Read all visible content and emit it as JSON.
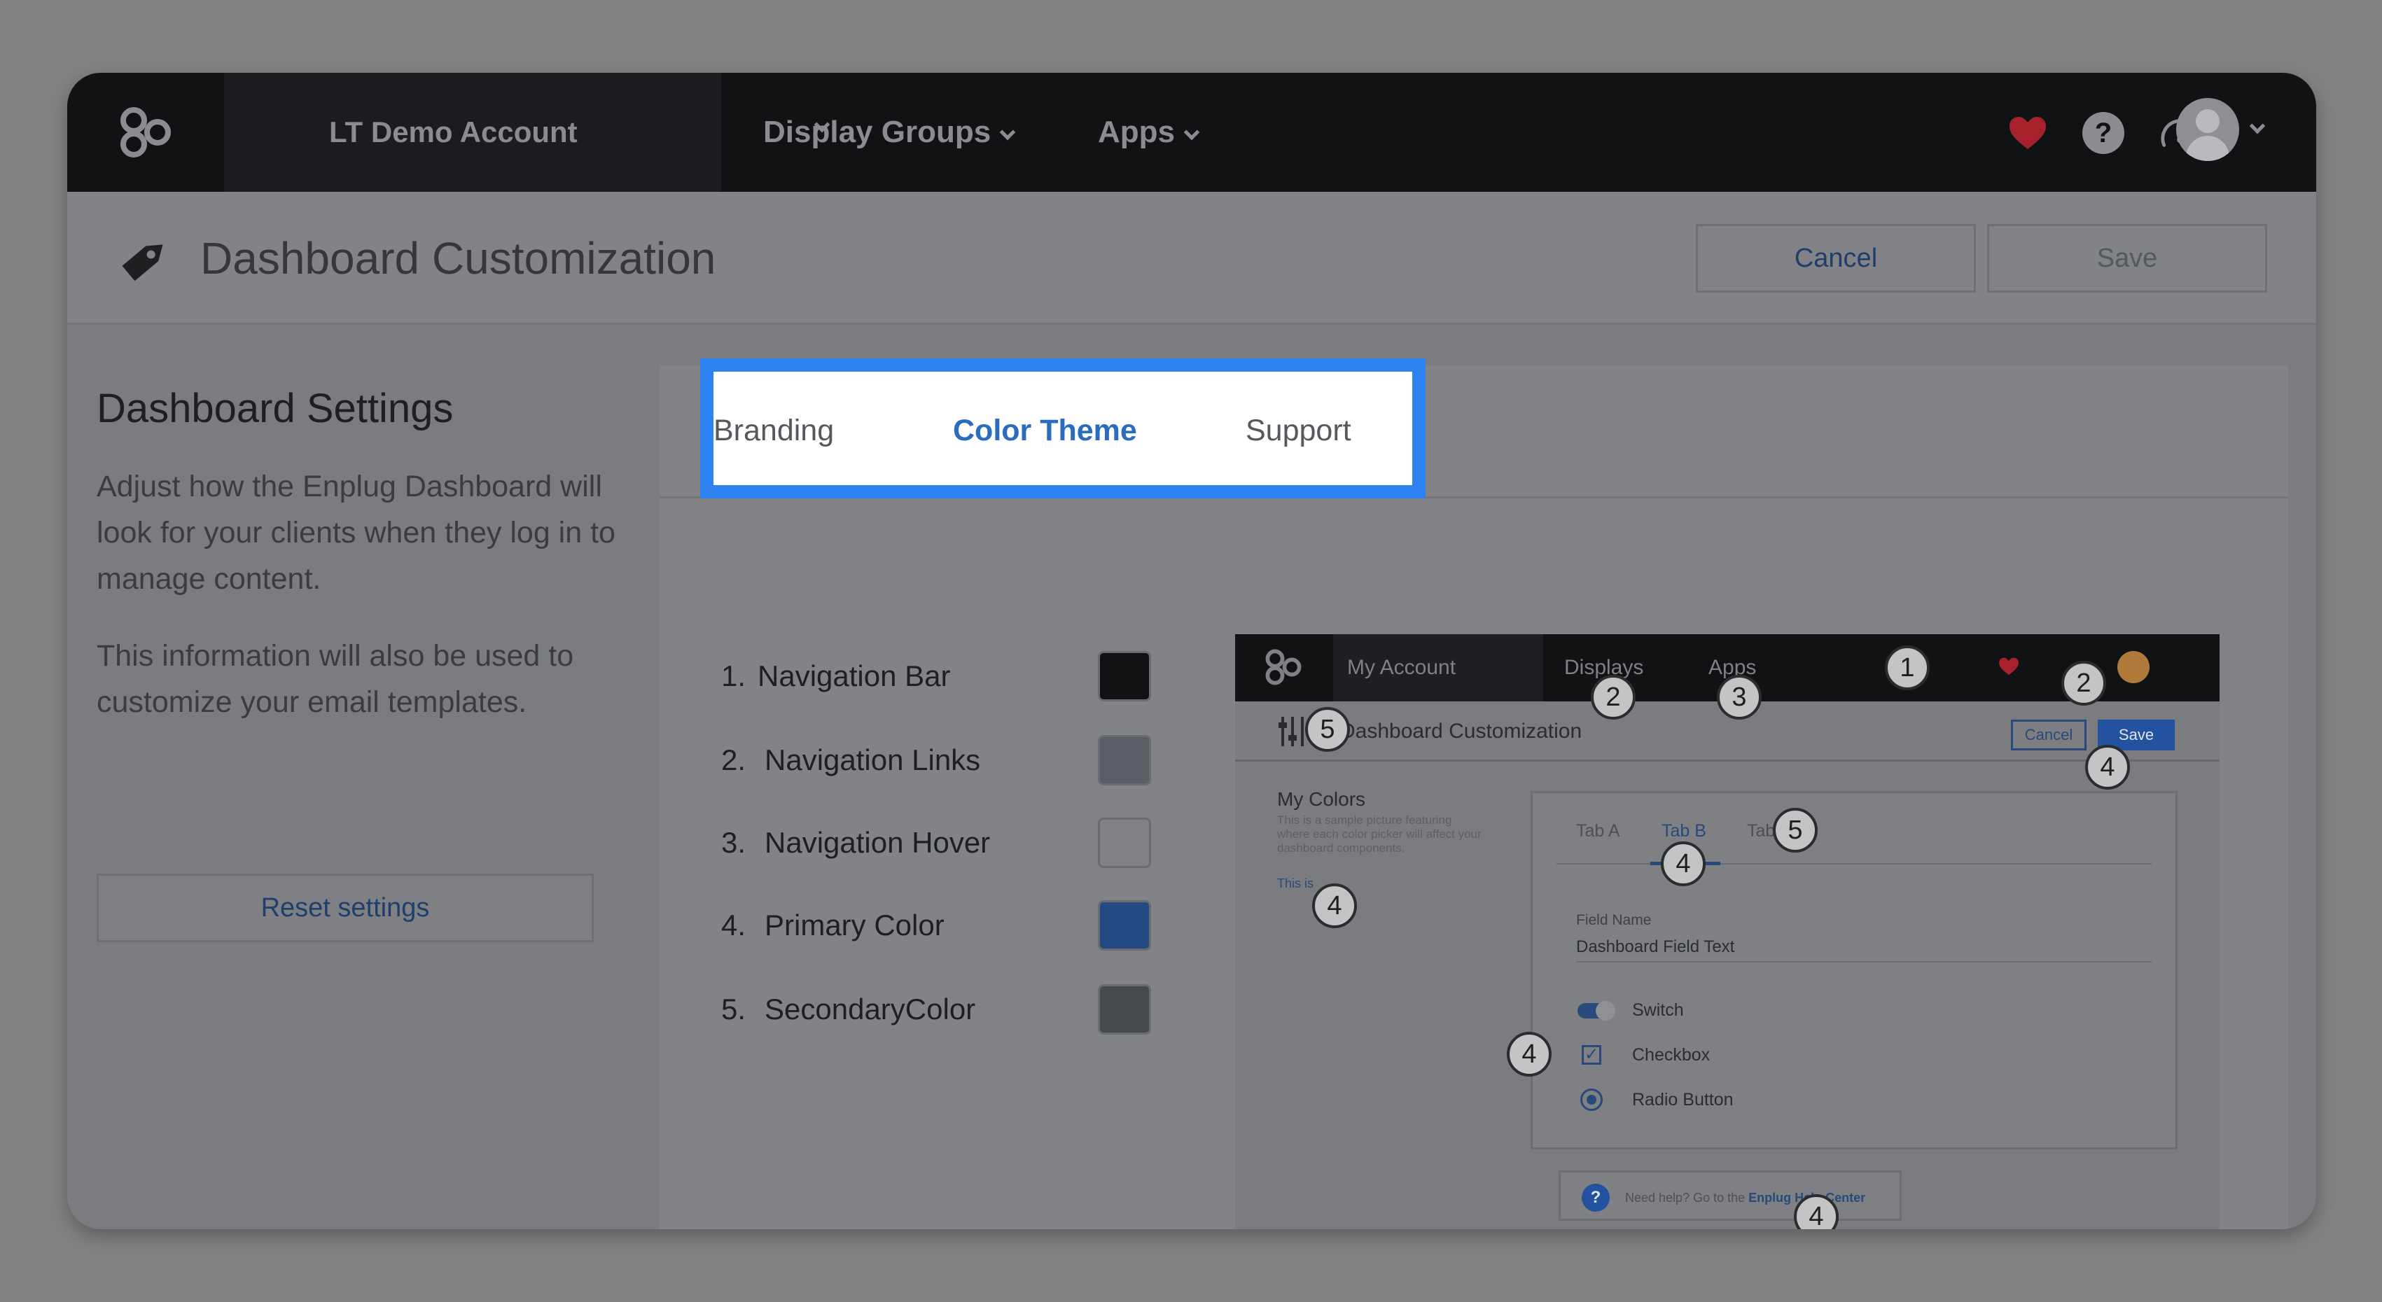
{
  "colors": {
    "highlight": "#2e82f2",
    "nav_bar": "#111214",
    "primary": "#2352a0"
  },
  "topnav": {
    "account_name": "LT Demo Account",
    "links": [
      "Display Groups",
      "Apps"
    ],
    "icons": [
      "enplug-logo-icon",
      "heart-icon",
      "help-icon",
      "dashboard-gauge-icon",
      "avatar-icon"
    ],
    "help_glyph": "?"
  },
  "header": {
    "title": "Dashboard Customization",
    "cancel_label": "Cancel",
    "save_label": "Save"
  },
  "settings": {
    "title": "Dashboard Settings",
    "desc1": "Adjust how the Enplug Dashboard will look for your clients when they log in to manage content.",
    "desc2": "This information will also be used to customize your email templates.",
    "reset_label": "Reset settings"
  },
  "tabs": {
    "items": [
      "Branding",
      "Color Theme",
      "Support"
    ],
    "active": "Color Theme"
  },
  "color_options": [
    {
      "num": "1.",
      "label": "Navigation Bar",
      "color": "#111214"
    },
    {
      "num": "2.",
      "label": "Navigation Links",
      "color": "#5a5e64"
    },
    {
      "num": "3.",
      "label": "Navigation Hover",
      "color": "#808285"
    },
    {
      "num": "4.",
      "label": "Primary Color",
      "color": "#234a82"
    },
    {
      "num": "5.",
      "label": "SecondaryColor",
      "color": "#45494e"
    }
  ],
  "preview": {
    "account": "My Account",
    "nav_displays": "Displays",
    "nav_apps": "Apps",
    "title": "Dashboard Customization",
    "cancel": "Cancel",
    "save": "Save",
    "my_colors": "My Colors",
    "desc": "This is a sample picture featuring where each color picker will affect your dashboard components.",
    "this_is": "This is",
    "tab_a": "Tab A",
    "tab_b": "Tab B",
    "tab_c": "Tab C",
    "field_name": "Field Name",
    "field_value": "Dashboard Field Text",
    "switch": "Switch",
    "checkbox": "Checkbox",
    "check_glyph": "✓",
    "radio": "Radio Button",
    "help_text": "Need help? Go to the ",
    "help_link": "Enplug Help Center",
    "help_glyph": "?",
    "badges": [
      "1",
      "2",
      "2",
      "3",
      "4",
      "4",
      "4",
      "4",
      "4",
      "5",
      "5"
    ]
  }
}
